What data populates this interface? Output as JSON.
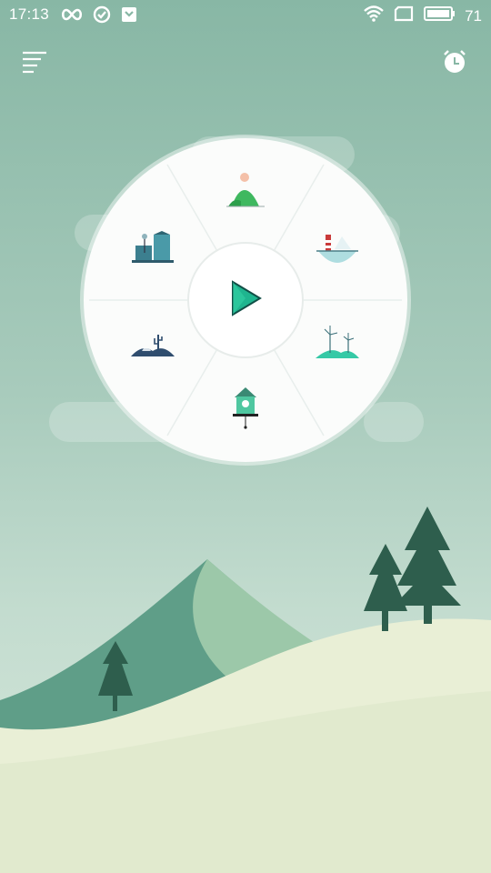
{
  "status_bar": {
    "time": "17:13",
    "left_icons": [
      "infinity-icon",
      "check-circle-icon",
      "shield-icon"
    ],
    "right_icons": [
      "wifi-icon",
      "sim-card-icon",
      "battery-icon"
    ],
    "battery_level": "71"
  },
  "header": {
    "menu_icon": "menu-icon",
    "alarm_icon": "alarm-clock-icon"
  },
  "wheel": {
    "center": "play-icon",
    "scenes": [
      {
        "name": "meadow-person-icon"
      },
      {
        "name": "lighthouse-boat-icon"
      },
      {
        "name": "wind-turbines-icon"
      },
      {
        "name": "cuckoo-clock-icon"
      },
      {
        "name": "desert-cactus-icon"
      },
      {
        "name": "city-buildings-icon"
      }
    ]
  },
  "colors": {
    "sky_top": "#88b7a5",
    "hill_dark": "#5f9e88",
    "hill_light": "#9cc8a9",
    "foreground": "#e9efd6",
    "tree": "#2e5e4d",
    "accent": "#1fb58f"
  }
}
